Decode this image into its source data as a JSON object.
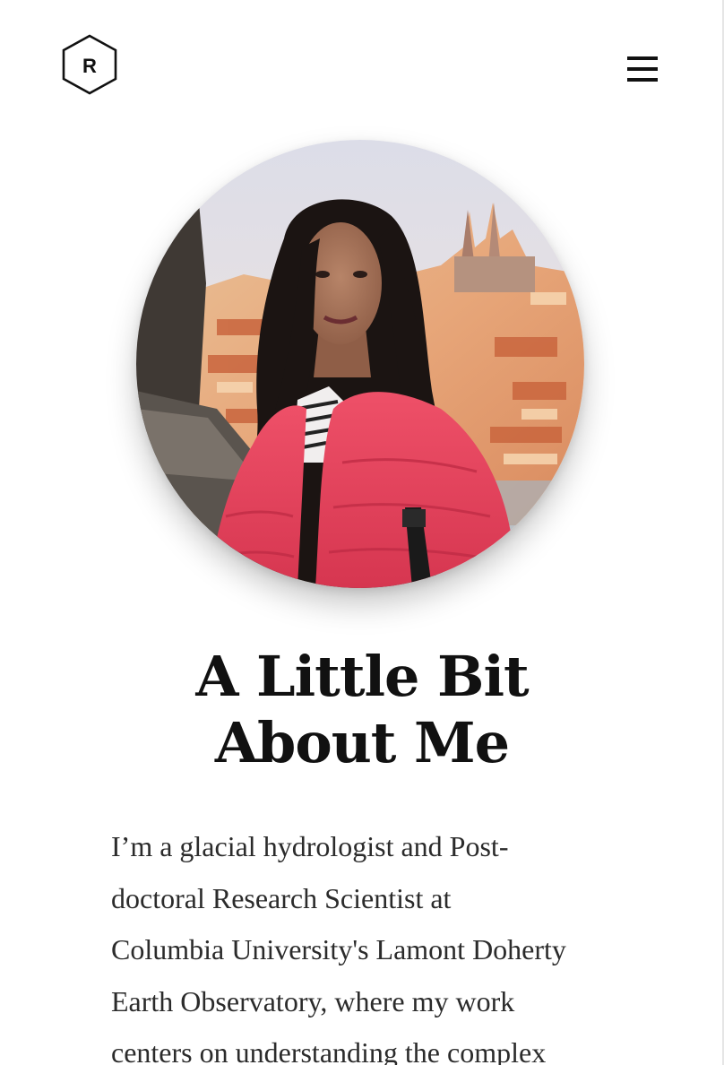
{
  "header": {
    "logo_letter": "R",
    "logo_icon": "hexagon-r-logo-icon",
    "menu_icon": "hamburger-menu-icon"
  },
  "profile": {
    "photo": "portrait-photo",
    "title_lines": [
      "A Little Bit",
      "About Me"
    ],
    "bio_lines": [
      "I’m a glacial hydrologist and Post-",
      "doctoral Research Scientist at",
      "Columbia University's Lamont Doherty",
      "Earth Observatory, where my work",
      "centers on understanding the complex"
    ]
  },
  "colors": {
    "text": "#111111",
    "body_text": "#2b2b2b",
    "background": "#ffffff",
    "jacket": "#e8475e"
  }
}
